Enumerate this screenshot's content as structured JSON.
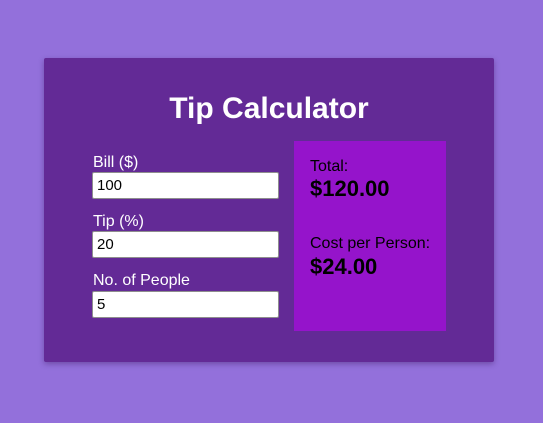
{
  "app": {
    "title": "Tip Calculator"
  },
  "form": {
    "bill": {
      "label": "Bill ($)",
      "value": "100"
    },
    "tip": {
      "label": "Tip (%)",
      "value": "20"
    },
    "people": {
      "label": "No. of People",
      "value": "5"
    }
  },
  "results": {
    "total_label": "Total:",
    "total_value": "$120.00",
    "per_person_label": "Cost per Person:",
    "per_person_value": "$24.00"
  },
  "colors": {
    "page_background": "#9370db",
    "card_background": "#632a96",
    "results_background": "#9514cb",
    "text_light": "#ffffff",
    "text_dark": "#000000"
  }
}
